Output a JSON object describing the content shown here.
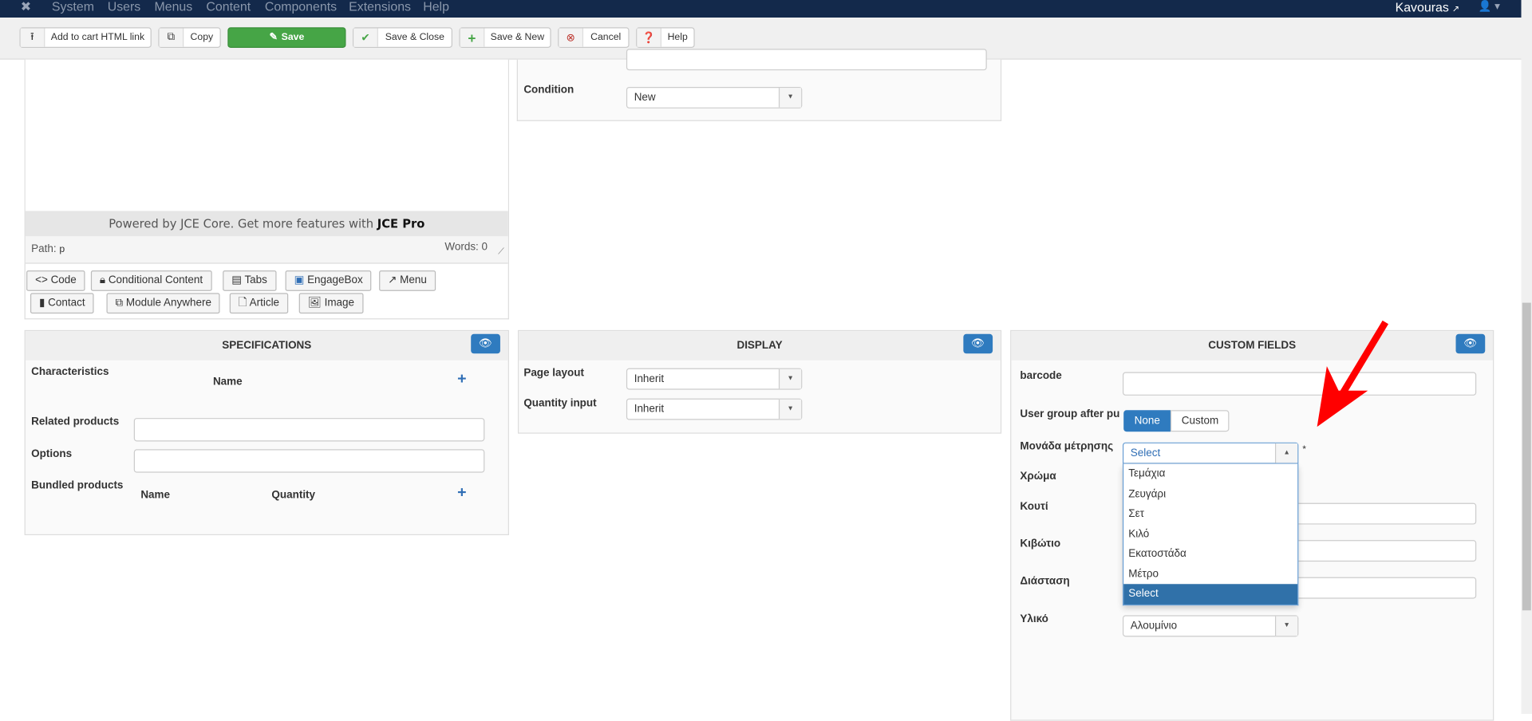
{
  "navbar": {
    "menu": [
      "System",
      "Users",
      "Menus",
      "Content",
      "Components",
      "Extensions",
      "Help"
    ],
    "site_name": "Kavouras"
  },
  "toolbar": {
    "add_to_cart": "Add to cart HTML link",
    "copy": "Copy",
    "save": "Save",
    "save_close": "Save & Close",
    "save_new": "Save & New",
    "cancel": "Cancel",
    "help": "Help"
  },
  "editor": {
    "powered_text": "Powered by JCE Core. Get more features with ",
    "powered_bold": "JCE Pro",
    "path_label": "Path:",
    "path_value": "p",
    "words": "Words: 0",
    "buttons": [
      "Code",
      "Conditional Content",
      "Tabs",
      "EngageBox",
      "Menu",
      "Contact",
      "Module Anywhere",
      "Article",
      "Image"
    ]
  },
  "details": {
    "condition_label": "Condition",
    "condition_value": "New"
  },
  "specifications": {
    "title": "SPECIFICATIONS",
    "characteristics": "Characteristics",
    "name_col": "Name",
    "related": "Related products",
    "options": "Options",
    "bundled": "Bundled products",
    "bundled_name": "Name",
    "bundled_qty": "Quantity"
  },
  "display": {
    "title": "DISPLAY",
    "page_layout": "Page layout",
    "page_layout_value": "Inherit",
    "quantity_input": "Quantity input",
    "quantity_input_value": "Inherit"
  },
  "custom_fields": {
    "title": "CUSTOM FIELDS",
    "barcode": "barcode",
    "user_group": "User group after pu",
    "none": "None",
    "custom": "Custom",
    "unit_label": "Μονάδα μέτρησης",
    "unit_value": "Select",
    "required": "*",
    "unit_options": [
      "Τεμάχια",
      "Ζευγάρι",
      "Σετ",
      "Κιλό",
      "Εκατοστάδα",
      "Μέτρο",
      "Select"
    ],
    "color_label": "Χρώμα",
    "box_label": "Κουτί",
    "crate_label": "Κιβώτιο",
    "dimension_label": "Διάσταση",
    "material_label": "Υλικό",
    "material_value": "Αλουμίνιο"
  },
  "colors": {
    "navbar": "#13294b",
    "save": "#46a546",
    "primary": "#2f7bbf",
    "highlight": "#3071a9",
    "arrow": "#ff0000"
  }
}
